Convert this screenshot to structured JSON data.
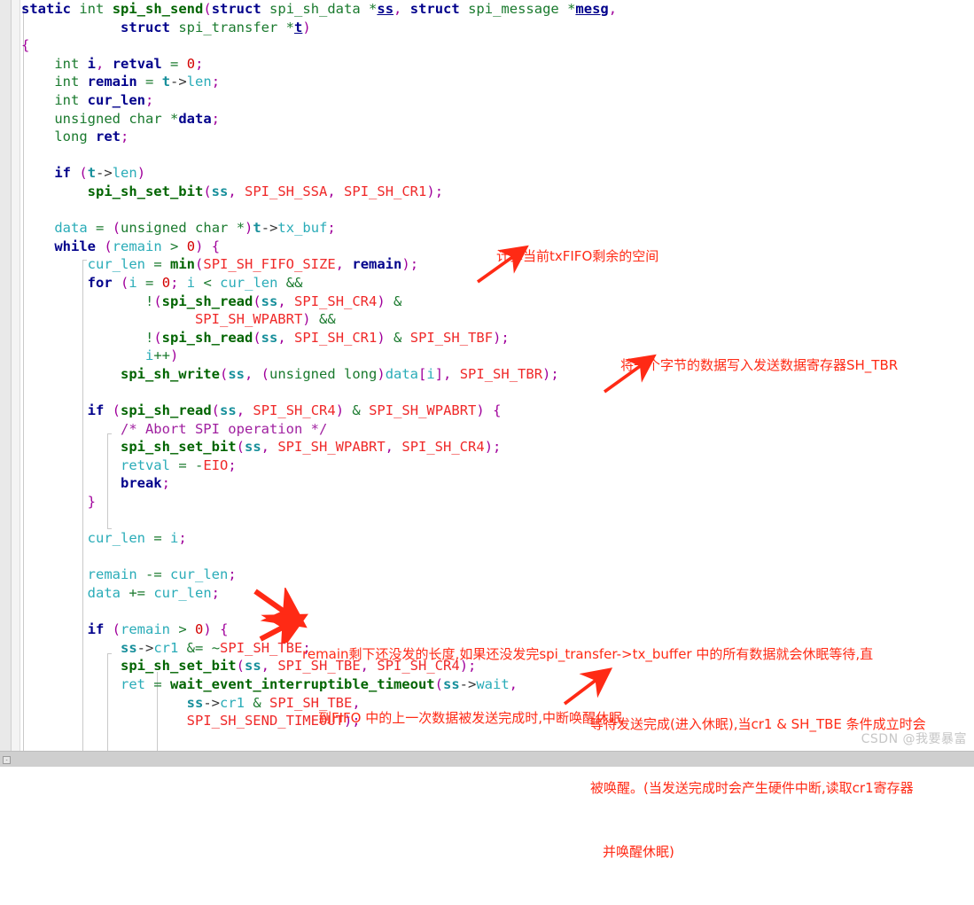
{
  "editor": {
    "language": "c",
    "gutter_visible": true,
    "fold_guides_visible": true
  },
  "code": {
    "lines": [
      "static int spi_sh_send(struct spi_sh_data *ss, struct spi_message *mesg,",
      "            struct spi_transfer *t)",
      "{",
      "    int i, retval = 0;",
      "    int remain = t->len;",
      "    int cur_len;",
      "    unsigned char *data;",
      "    long ret;",
      "",
      "    if (t->len)",
      "        spi_sh_set_bit(ss, SPI_SH_SSA, SPI_SH_CR1);",
      "",
      "    data = (unsigned char *)t->tx_buf;",
      "    while (remain > 0) {",
      "        cur_len = min(SPI_SH_FIFO_SIZE, remain);",
      "        for (i = 0; i < cur_len &&",
      "               !(spi_sh_read(ss, SPI_SH_CR4) &",
      "                     SPI_SH_WPABRT) &&",
      "               !(spi_sh_read(ss, SPI_SH_CR1) & SPI_SH_TBF);",
      "               i++)",
      "            spi_sh_write(ss, (unsigned long)data[i], SPI_SH_TBR);",
      "",
      "        if (spi_sh_read(ss, SPI_SH_CR4) & SPI_SH_WPABRT) {",
      "            /* Abort SPI operation */",
      "            spi_sh_set_bit(ss, SPI_SH_WPABRT, SPI_SH_CR4);",
      "            retval = -EIO;",
      "            break;",
      "        }",
      "",
      "        cur_len = i;",
      "",
      "        remain -= cur_len;",
      "        data += cur_len;",
      "",
      "        if (remain > 0) {",
      "            ss->cr1 &= ~SPI_SH_TBE;",
      "            spi_sh_set_bit(ss, SPI_SH_TBE, SPI_SH_CR4);",
      "            ret = wait_event_interruptible_timeout(ss->wait,",
      "                    ss->cr1 & SPI_SH_TBE,",
      "                    SPI_SH_SEND_TIMEOUT);"
    ]
  },
  "annotations": [
    {
      "id": "anno-fifo-space",
      "text": "计算当前txFIFO剩余的空间",
      "color": "#ff2a15"
    },
    {
      "id": "anno-write-byte",
      "text": "将一个字节的数据写入发送数据寄存器SH_TBR",
      "color": "#ff2a15"
    },
    {
      "id": "anno-remain",
      "line1": "remain剩下还没发的长度,如果还没发完spi_transfer->tx_buffer 中的所有数据就会休眠等待,直",
      "line2": "到FIFO 中的上一次数据被发送完成时,中断唤醒休眠",
      "color": "#ff2a15"
    },
    {
      "id": "anno-wait",
      "line1": "等待发送完成(进入休眠),当cr1 & SH_TBE 条件成立时会",
      "line2": "被唤醒。(当发送完成时会产生硬件中断,读取cr1寄存器",
      "line3": "并唤醒休眠)",
      "color": "#ff2a15"
    }
  ],
  "watermark": {
    "text": "CSDN @我要暴富"
  },
  "colors": {
    "keyword": "#00008b",
    "type": "#1a7a2e",
    "function": "#006400",
    "identifier": "#2aacb8",
    "constant": "#ef2929",
    "comment": "#a020a0",
    "punctuation": "#a0009b",
    "annotation": "#ff2a15",
    "background": "#ffffff"
  }
}
